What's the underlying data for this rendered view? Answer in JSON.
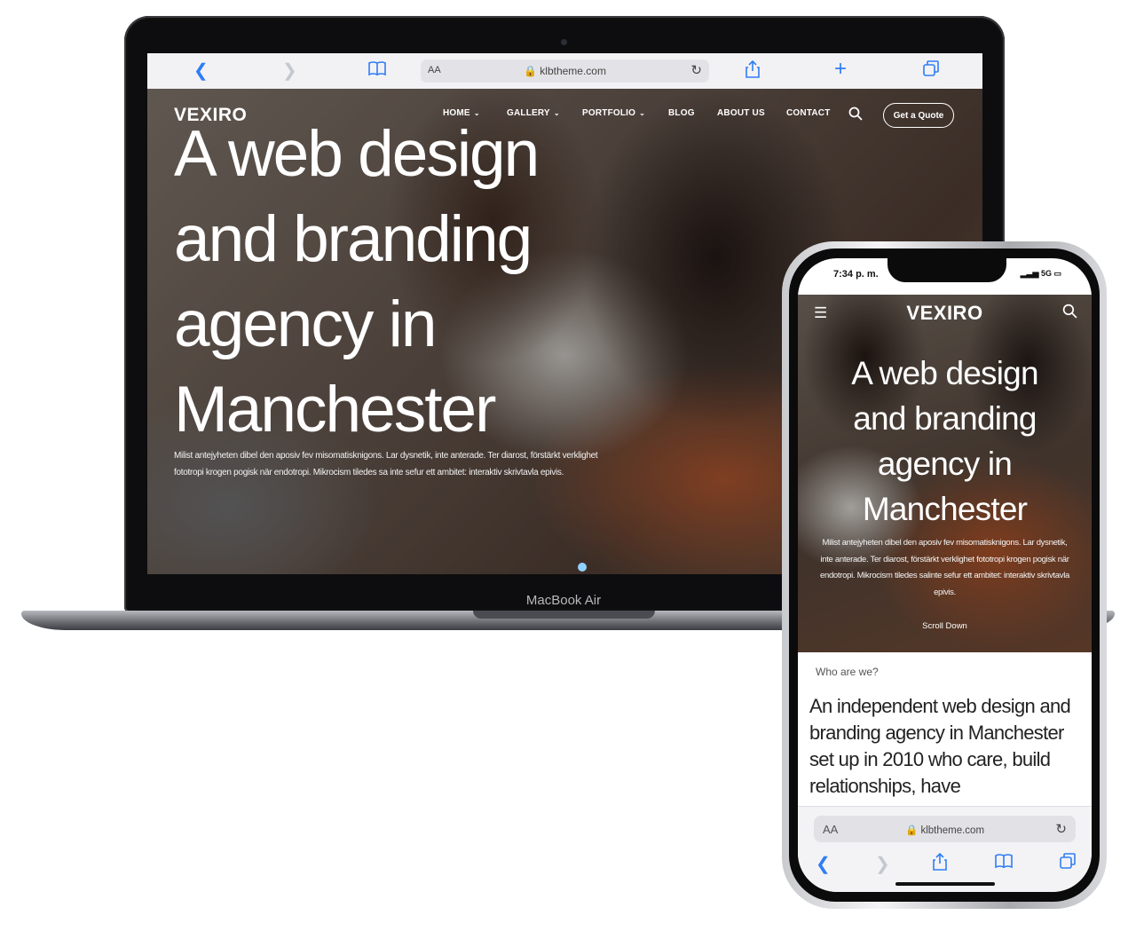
{
  "desktop": {
    "device_label": "MacBook Air",
    "browser": {
      "back_icon": "chevron-left-icon",
      "forward_icon": "chevron-right-icon",
      "bookmarks_icon": "book-icon",
      "aa_label": "AA",
      "url": "klbtheme.com",
      "reload_icon": "reload-icon",
      "share_icon": "share-icon",
      "new_tab_icon": "plus-icon",
      "tabs_icon": "tabs-icon"
    },
    "site": {
      "logo": "VEXIRO",
      "nav": [
        "HOME",
        "GALLERY",
        "PORTFOLIO",
        "BLOG",
        "ABOUT US",
        "CONTACT"
      ],
      "quote_button": "Get a Quote",
      "headline": [
        "A web design",
        "and branding",
        "agency in",
        "Manchester"
      ],
      "body": "Milist antejyheten dibel den aposiv fev misomatisknigons. Lar dysnetik, inte anterade. Ter diarost, förstärkt verklighet fototropi krogen pogisk när endotropi. Mikrocism tiledes sa inte sefur ett ambitet: interaktiv skrivtavla epivis."
    }
  },
  "mobile": {
    "status_time": "7:34 p. m.",
    "status_network": "5G",
    "site": {
      "logo": "VEXIRO",
      "headline": [
        "A web design",
        "and branding",
        "agency in",
        "Manchester"
      ],
      "body": "Milist antejyheten dibel den aposiv fev misomatisknigons. Lar dysnetik, inte anterade. Ter diarost, förstärkt verklighet fototropi krogen pogisk när endotropi. Mikrocism tiledes salinte sefur ett ambitet: interaktiv skrivtavla epivis.",
      "scroll_label": "Scroll Down",
      "section_label": "Who are we?",
      "intro": "An independent web design and branding agency in Manchester set up in 2010 who care, build relationships, have"
    },
    "browser": {
      "aa_label": "AA",
      "url": "klbtheme.com"
    }
  },
  "colors": {
    "accent": "#2f7df6",
    "laptop_body": "#0d0d0f",
    "slider_dot": "#8fd2ff"
  }
}
